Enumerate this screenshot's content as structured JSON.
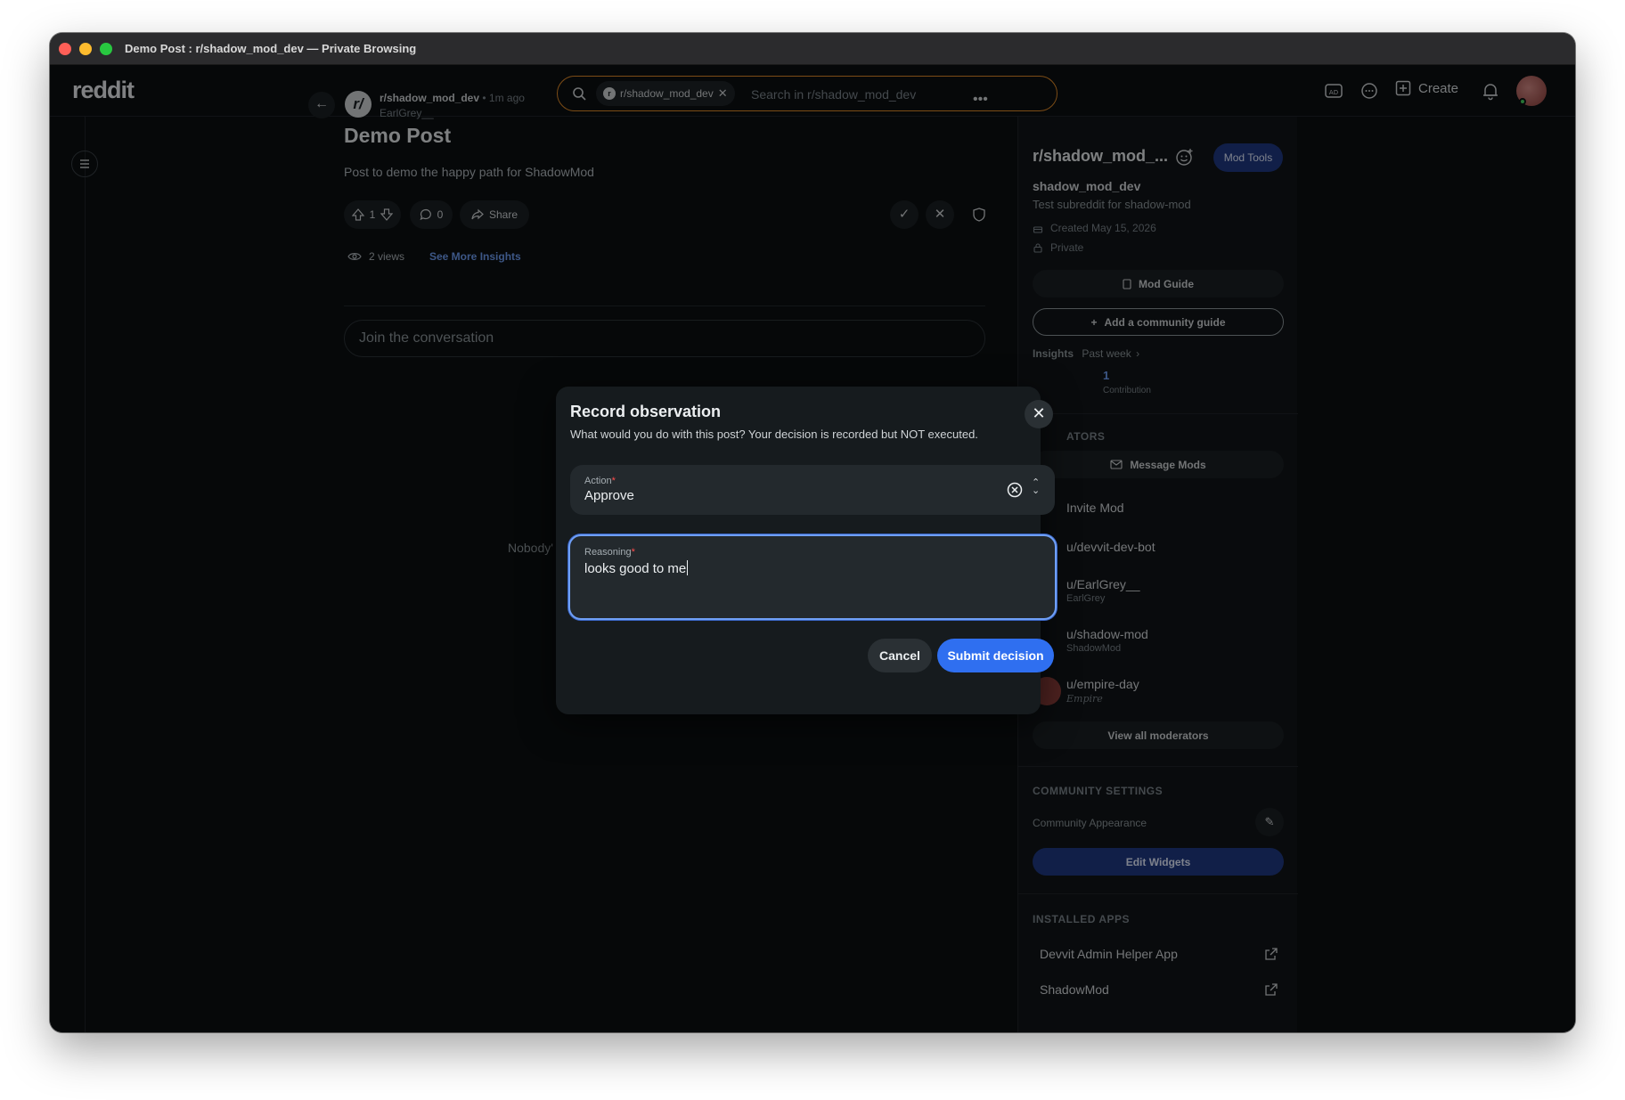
{
  "window": {
    "title": "Demo Post : r/shadow_mod_dev — Private Browsing"
  },
  "header": {
    "logo": "reddit",
    "search_chip": "r/shadow_mod_dev",
    "search_placeholder": "Search in r/shadow_mod_dev",
    "create_label": "Create"
  },
  "post": {
    "subreddit": "r/shadow_mod_dev",
    "time": "• 1m ago",
    "author": "EarlGrey__",
    "title": "Demo Post",
    "body": "Post to demo the happy path for ShadowMod",
    "votes": "1",
    "comments": "0",
    "share_label": "Share",
    "views": "2 views",
    "insights_link": "See More Insights",
    "join_placeholder": "Join the conversation",
    "empty_text": "Nobody'"
  },
  "sidebar": {
    "title": "r/shadow_mod_...",
    "mod_tools_label": "Mod Tools",
    "sub_name": "shadow_mod_dev",
    "description": "Test subreddit for shadow-mod",
    "created": "Created May 15, 2026",
    "privacy": "Private",
    "mod_guide_label": "Mod Guide",
    "add_guide_label": "Add a community guide",
    "insights_label": "Insights",
    "insights_period": "Past week",
    "contribution_count": "1",
    "contribution_label": "Contribution",
    "moderators_header": "ATORS",
    "message_mods_label": "Message Mods",
    "invite_mod_label": "Invite Mod",
    "moderators": [
      {
        "name": "u/devvit-dev-bot",
        "flair": ""
      },
      {
        "name": "u/EarlGrey__",
        "flair": "EarlGrey"
      },
      {
        "name": "u/shadow-mod",
        "flair": "ShadowMod"
      },
      {
        "name": "u/empire-day",
        "flair": "Empire"
      }
    ],
    "view_all_mods_label": "View all moderators",
    "community_settings_header": "COMMUNITY SETTINGS",
    "community_appearance_label": "Community Appearance",
    "edit_widgets_label": "Edit Widgets",
    "installed_apps_header": "INSTALLED APPS",
    "apps": [
      "Devvit Admin Helper App",
      "ShadowMod"
    ]
  },
  "modal": {
    "title": "Record observation",
    "subtitle": "What would you do with this post? Your decision is recorded but NOT executed.",
    "action_label": "Action",
    "action_value": "Approve",
    "reasoning_label": "Reasoning",
    "reasoning_value": "looks good to me",
    "required_marker": "*",
    "cancel_label": "Cancel",
    "submit_label": "Submit decision"
  },
  "colors": {
    "accent": "#2f6ff0",
    "mod_blue": "#1f3a83",
    "search_border": "#e28b28",
    "background": "#0b0f12"
  }
}
